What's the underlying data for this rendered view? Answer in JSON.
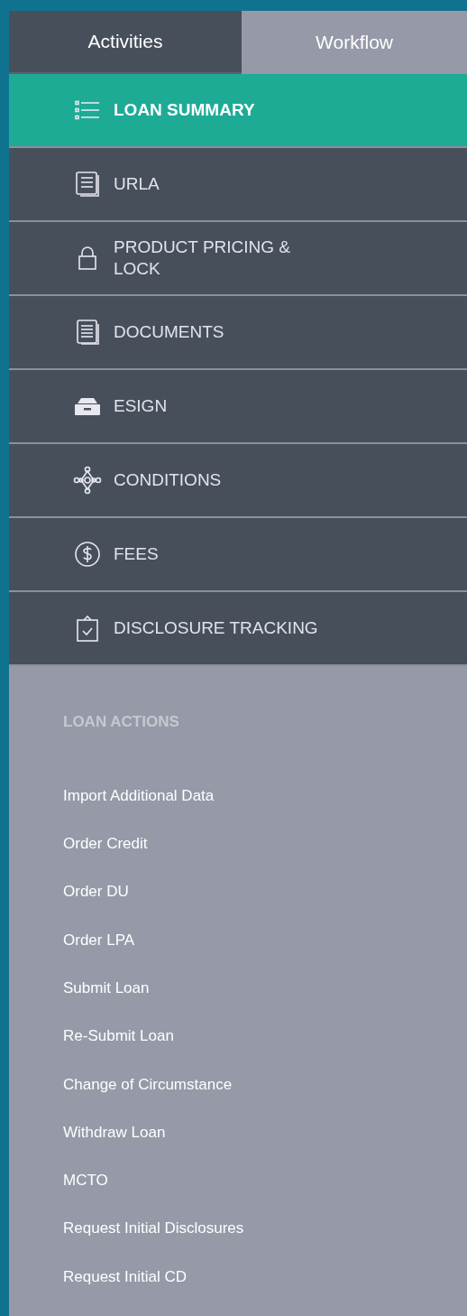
{
  "tabs": [
    {
      "label": "Activities",
      "selected": true
    },
    {
      "label": "Workflow",
      "selected": false
    }
  ],
  "nav_items": [
    {
      "label": "LOAN SUMMARY",
      "kind": "list",
      "selected": true
    },
    {
      "label": "URLA",
      "kind": "form",
      "selected": false
    },
    {
      "label": "PRODUCT PRICING & LOCK",
      "kind": "lock",
      "selected": false
    },
    {
      "label": "DOCUMENTS",
      "kind": "document",
      "selected": false
    },
    {
      "label": "ESIGN",
      "kind": "tray",
      "selected": false
    },
    {
      "label": "CONDITIONS",
      "kind": "network",
      "selected": false
    },
    {
      "label": "FEES",
      "kind": "dollar",
      "selected": false
    },
    {
      "label": "DISCLOSURE TRACKING",
      "kind": "clipboard",
      "selected": false
    }
  ],
  "loan_actions": {
    "heading": "LOAN ACTIONS",
    "items": [
      "Import Additional Data",
      "Order Credit",
      "Order DU",
      "Order LPA",
      "Submit Loan",
      "Re-Submit Loan",
      "Change of Circumstance",
      "Withdraw Loan",
      "MCTO",
      "Request Initial Disclosures",
      "Request Initial CD"
    ]
  }
}
